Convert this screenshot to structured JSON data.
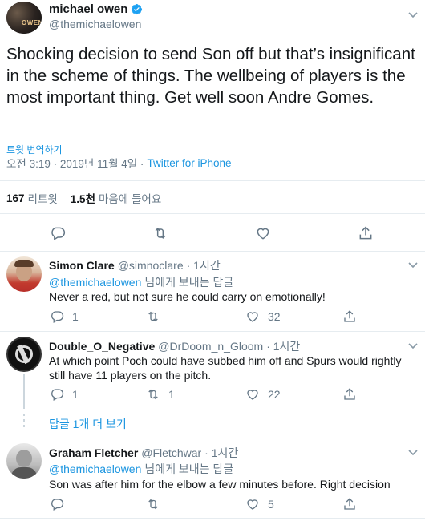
{
  "main_tweet": {
    "author_name": "michael owen",
    "handle": "@themichaelowen",
    "text": "Shocking decision to send Son off but that’s insignificant in the scheme of things. The wellbeing of players is the most important thing. Get well soon Andre Gomes.",
    "translate_label": "트윗 번역하기",
    "timestamp": "오전 3:19 · 2019년 11월 4일 ·",
    "source": "Twitter for iPhone",
    "retweet_count": "167",
    "retweet_label": "리트윗",
    "like_count": "1.5천",
    "like_label": "마음에 들어요",
    "avatar_text": "OWEN"
  },
  "replies": [
    {
      "name": "Simon Clare",
      "handle": "@simnoclare",
      "time": "· 1시간",
      "reply_to_handle": "@themichaelowen",
      "reply_to_suffix": "님에게 보내는 답글",
      "text": "Never a red,  but not sure he could carry on emotionally!",
      "reply_count": "1",
      "retweet_count": "",
      "like_count": "32"
    },
    {
      "name": "Double_O_Negative",
      "handle": "@DrDoom_n_Gloom",
      "time": "· 1시간",
      "text": "At which point Poch could have subbed him off and Spurs would rightly still have 11 players on the pitch.",
      "reply_count": "1",
      "retweet_count": "1",
      "like_count": "22"
    },
    {
      "name": "Graham Fletcher",
      "handle": "@Fletchwar",
      "time": "· 1시간",
      "reply_to_handle": "@themichaelowen",
      "reply_to_suffix": "님에게 보내는 답글",
      "text": "Son was after him for the elbow a few minutes before. Right decision",
      "reply_count": "",
      "retweet_count": "",
      "like_count": "5"
    }
  ],
  "thread_more_label": "답글 1개 더 보기",
  "colors": {
    "link": "#1b95e0",
    "verified": "#1da1f2",
    "muted": "#657786",
    "divider": "#e6ecf0"
  }
}
